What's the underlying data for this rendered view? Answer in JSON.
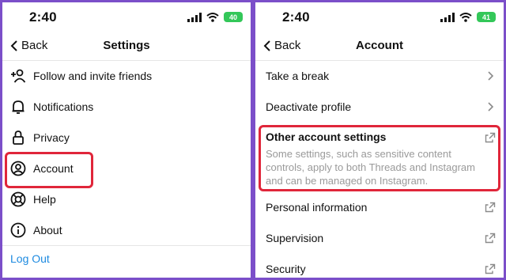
{
  "left": {
    "status_time": "2:40",
    "battery": "40",
    "back_label": "Back",
    "title": "Settings",
    "items": [
      {
        "label": "Follow and invite friends",
        "icon": "add-person-icon"
      },
      {
        "label": "Notifications",
        "icon": "bell-icon"
      },
      {
        "label": "Privacy",
        "icon": "lock-icon"
      },
      {
        "label": "Account",
        "icon": "account-circle-icon"
      },
      {
        "label": "Help",
        "icon": "lifebuoy-icon"
      },
      {
        "label": "About",
        "icon": "info-icon"
      }
    ],
    "logout_label": "Log Out"
  },
  "right": {
    "status_time": "2:40",
    "battery": "41",
    "back_label": "Back",
    "title": "Account",
    "items": [
      {
        "label": "Take a break",
        "trail": "chevron-right-icon"
      },
      {
        "label": "Deactivate profile",
        "trail": "chevron-right-icon"
      }
    ],
    "other_settings": {
      "title": "Other account settings",
      "description": "Some settings, such as sensitive content controls, apply to both Threads and Instagram and can be managed on Instagram."
    },
    "links": [
      {
        "label": "Personal information",
        "trail": "external-link-icon"
      },
      {
        "label": "Supervision",
        "trail": "external-link-icon"
      },
      {
        "label": "Security",
        "trail": "external-link-icon"
      }
    ]
  },
  "colors": {
    "frame": "#7b4fc9",
    "highlight": "#e0263a",
    "link": "#1d8ae0",
    "battery": "#33c759"
  }
}
